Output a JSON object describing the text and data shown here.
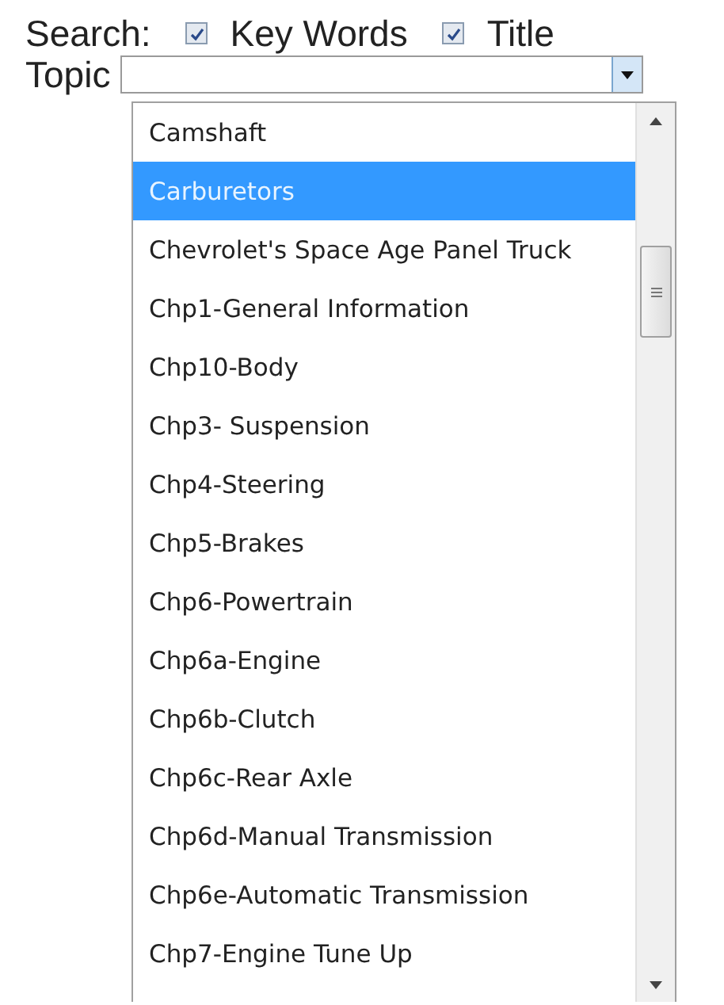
{
  "search": {
    "label": "Search:",
    "options": [
      {
        "label": "Key Words",
        "checked": true
      },
      {
        "label": "Title",
        "checked": true
      }
    ]
  },
  "topic": {
    "label": "Topic",
    "expanded": true,
    "options": [
      {
        "label": "Camshaft",
        "selected": false
      },
      {
        "label": "Carburetors",
        "selected": true
      },
      {
        "label": "Chevrolet's Space Age Panel Truck",
        "selected": false
      },
      {
        "label": "Chp1-General Information",
        "selected": false
      },
      {
        "label": "Chp10-Body",
        "selected": false
      },
      {
        "label": "Chp3- Suspension",
        "selected": false
      },
      {
        "label": "Chp4-Steering",
        "selected": false
      },
      {
        "label": "Chp5-Brakes",
        "selected": false
      },
      {
        "label": "Chp6-Powertrain",
        "selected": false
      },
      {
        "label": "Chp6a-Engine",
        "selected": false
      },
      {
        "label": "Chp6b-Clutch",
        "selected": false
      },
      {
        "label": "Chp6c-Rear Axle",
        "selected": false
      },
      {
        "label": "Chp6d-Manual Transmission",
        "selected": false
      },
      {
        "label": "Chp6e-Automatic Transmission",
        "selected": false
      },
      {
        "label": "Chp7-Engine Tune Up",
        "selected": false
      }
    ]
  }
}
